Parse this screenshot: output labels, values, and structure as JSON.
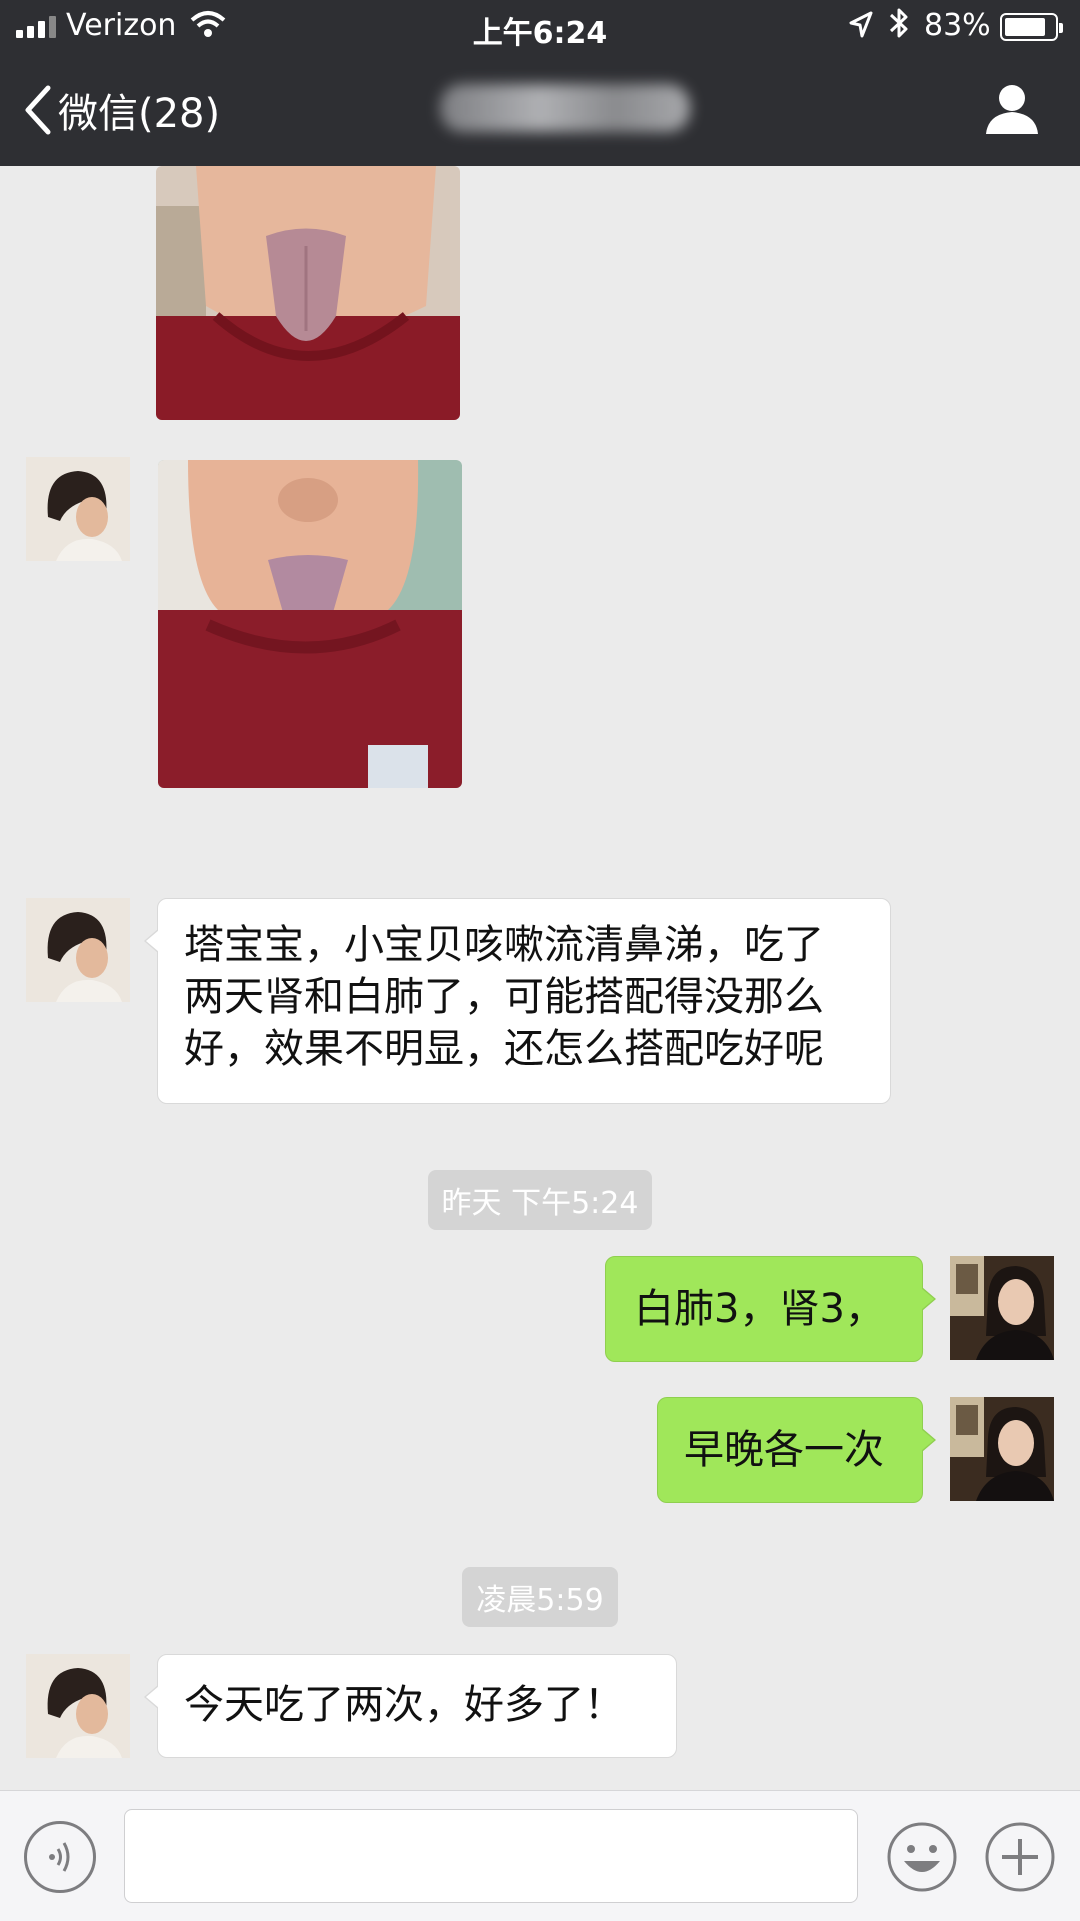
{
  "status_bar": {
    "carrier": "Verizon",
    "time": "上午6:24",
    "battery_percent": "83%",
    "battery_level": 0.83,
    "icons": [
      "signal-icon",
      "wifi-icon",
      "location-arrow-icon",
      "bluetooth-icon",
      "battery-icon"
    ]
  },
  "nav": {
    "back_label": "微信(28)",
    "title": "",
    "title_obscured": true,
    "icons": [
      "chevron-left-icon",
      "profile-icon"
    ]
  },
  "messages": [
    {
      "kind": "image",
      "sender": "contact",
      "alt": "child sticking out tongue, cropped at top"
    },
    {
      "kind": "image",
      "sender": "contact",
      "alt": "child sticking out tongue"
    },
    {
      "kind": "text",
      "sender": "contact",
      "lines": [
        "塔宝宝，小宝贝咳嗽流清鼻涕，吃了",
        "两天肾和白肺了，可能搭配得没那么",
        "好，效果不明显，还怎么搭配吃好呢"
      ]
    },
    {
      "kind": "timestamp",
      "text": "昨天 下午5:24"
    },
    {
      "kind": "text",
      "sender": "me",
      "text": "白肺3，肾3，"
    },
    {
      "kind": "text",
      "sender": "me",
      "text": "早晚各一次"
    },
    {
      "kind": "timestamp",
      "text": "凌晨5:59"
    },
    {
      "kind": "text",
      "sender": "contact",
      "text": "今天吃了两次，好多了！"
    }
  ],
  "input_bar": {
    "value": "",
    "icons": [
      "voice-icon",
      "emoji-icon",
      "plus-icon"
    ]
  },
  "colors": {
    "nav_bg": "#2e2f33",
    "chat_bg": "#ebebeb",
    "outgoing_bubble": "#a0e75a",
    "incoming_bubble": "#ffffff",
    "timestamp_bg": "#d4d4d4"
  }
}
